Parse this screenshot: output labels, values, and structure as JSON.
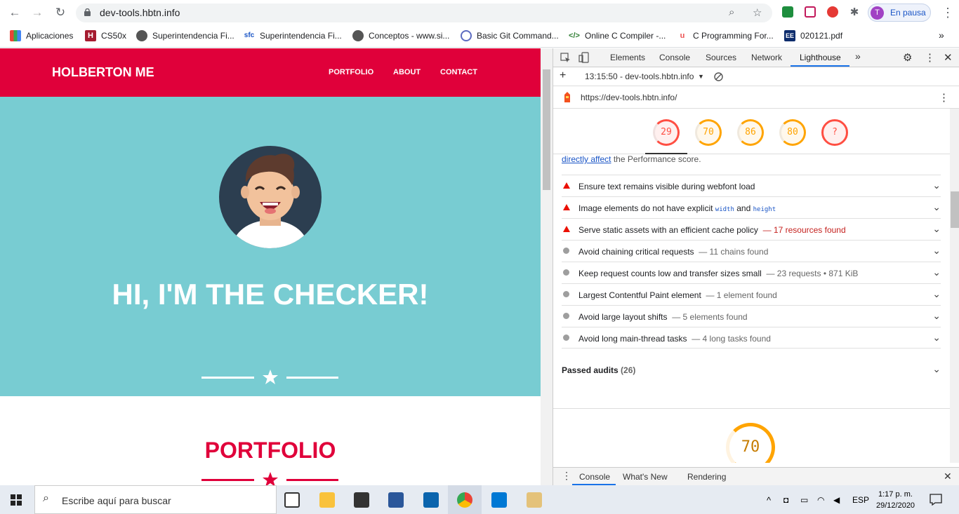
{
  "browser": {
    "url": "dev-tools.hbtn.info",
    "profile_initial": "T",
    "profile_label": "En pausa"
  },
  "bookmarks": [
    {
      "label": "Aplicaciones",
      "icon": "apps-grid-icon"
    },
    {
      "label": "CS50x",
      "icon": "harvard-shield-icon"
    },
    {
      "label": "Superintendencia Fi...",
      "icon": "globe-icon"
    },
    {
      "label": "Superintendencia Fi...",
      "icon": "sfc-logo-icon"
    },
    {
      "label": "Conceptos - www.si...",
      "icon": "globe-icon"
    },
    {
      "label": "Basic Git Command...",
      "icon": "circle-icon"
    },
    {
      "label": "Online C Compiler -...",
      "icon": "code-brackets-icon"
    },
    {
      "label": "C Programming For...",
      "icon": "udemy-icon"
    },
    {
      "label": "020121.pdf",
      "icon": "ee-icon"
    }
  ],
  "site": {
    "brand": "HOLBERTON ME",
    "nav": [
      "PORTFOLIO",
      "ABOUT",
      "CONTACT"
    ],
    "hero_title": "HI, I'M THE CHECKER!",
    "section_title": "PORTFOLIO",
    "colors": {
      "red": "#e0003a",
      "teal": "#78ccd2"
    }
  },
  "devtools": {
    "tabs": [
      "Elements",
      "Console",
      "Sources",
      "Network",
      "Lighthouse"
    ],
    "active_tab": "Lighthouse",
    "report_label": "13:15:50 - dev-tools.hbtn.info",
    "report_url": "https://dev-tools.hbtn.info/",
    "gauges": [
      {
        "value": "29",
        "color": "#ff4e42"
      },
      {
        "value": "70",
        "color": "#ffa400"
      },
      {
        "value": "86",
        "color": "#ffa400"
      },
      {
        "value": "80",
        "color": "#ffa400"
      },
      {
        "value": "?",
        "color": "#ff4e42"
      }
    ],
    "intro_link": "directly affect",
    "intro_rest": "the Performance score.",
    "audits": [
      {
        "type": "fail",
        "text": "Ensure text remains visible during webfont load",
        "extra": ""
      },
      {
        "type": "fail",
        "text": "Image elements do not have explicit",
        "code1": "width",
        "and": "and",
        "code2": "height",
        "extra": ""
      },
      {
        "type": "fail",
        "text": "Serve static assets with an efficient cache policy",
        "extra": "— 17 resources found"
      },
      {
        "type": "info",
        "text": "Avoid chaining critical requests",
        "extra": "— 11 chains found"
      },
      {
        "type": "info",
        "text": "Keep request counts low and transfer sizes small",
        "extra": "— 23 requests • 871 KiB"
      },
      {
        "type": "info",
        "text": "Largest Contentful Paint element",
        "extra": "— 1 element found"
      },
      {
        "type": "info",
        "text": "Avoid large layout shifts",
        "extra": "— 5 elements found"
      },
      {
        "type": "info",
        "text": "Avoid long main-thread tasks",
        "extra": "— 4 long tasks found"
      }
    ],
    "passed_label": "Passed audits",
    "passed_count": "(26)",
    "big_gauge": "70",
    "drawer_tabs": [
      "Console",
      "What's New",
      "Rendering"
    ]
  },
  "taskbar": {
    "search_placeholder": "Escribe aquí para buscar",
    "lang": "ESP",
    "time": "1:17 p. m.",
    "date": "29/12/2020"
  }
}
